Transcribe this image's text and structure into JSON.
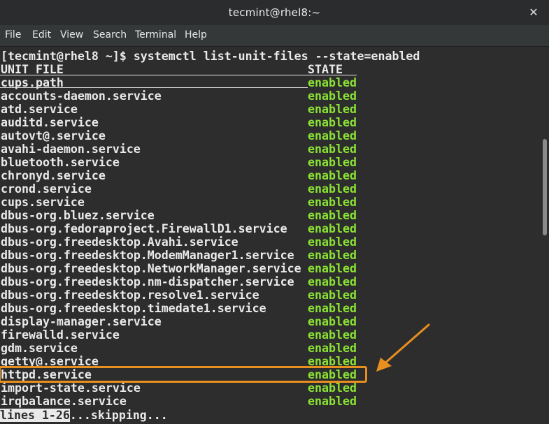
{
  "window": {
    "title": "tecmint@rhel8:~",
    "close_glyph": "✕"
  },
  "menu": [
    "File",
    "Edit",
    "View",
    "Search",
    "Terminal",
    "Help"
  ],
  "terminal": {
    "prompt_line": "[tecmint@rhel8 ~]$ systemctl list-unit-files --state=enabled",
    "header": {
      "unit": "UNIT FILE",
      "state": "STATE"
    },
    "rows": [
      {
        "unit": "cups.path",
        "state": "enabled"
      },
      {
        "unit": "accounts-daemon.service",
        "state": "enabled"
      },
      {
        "unit": "atd.service",
        "state": "enabled"
      },
      {
        "unit": "auditd.service",
        "state": "enabled"
      },
      {
        "unit": "autovt@.service",
        "state": "enabled"
      },
      {
        "unit": "avahi-daemon.service",
        "state": "enabled"
      },
      {
        "unit": "bluetooth.service",
        "state": "enabled"
      },
      {
        "unit": "chronyd.service",
        "state": "enabled"
      },
      {
        "unit": "crond.service",
        "state": "enabled"
      },
      {
        "unit": "cups.service",
        "state": "enabled"
      },
      {
        "unit": "dbus-org.bluez.service",
        "state": "enabled"
      },
      {
        "unit": "dbus-org.fedoraproject.FirewallD1.service",
        "state": "enabled"
      },
      {
        "unit": "dbus-org.freedesktop.Avahi.service",
        "state": "enabled"
      },
      {
        "unit": "dbus-org.freedesktop.ModemManager1.service",
        "state": "enabled"
      },
      {
        "unit": "dbus-org.freedesktop.NetworkManager.service",
        "state": "enabled"
      },
      {
        "unit": "dbus-org.freedesktop.nm-dispatcher.service",
        "state": "enabled"
      },
      {
        "unit": "dbus-org.freedesktop.resolve1.service",
        "state": "enabled"
      },
      {
        "unit": "dbus-org.freedesktop.timedate1.service",
        "state": "enabled"
      },
      {
        "unit": "display-manager.service",
        "state": "enabled"
      },
      {
        "unit": "firewalld.service",
        "state": "enabled"
      },
      {
        "unit": "gdm.service",
        "state": "enabled"
      },
      {
        "unit": "getty@.service",
        "state": "enabled"
      },
      {
        "unit": "httpd.service",
        "state": "enabled"
      },
      {
        "unit": "import-state.service",
        "state": "enabled"
      },
      {
        "unit": "irqbalance.service",
        "state": "enabled"
      }
    ],
    "pager": {
      "inverse": "lines 1-26",
      "rest": "...skipping..."
    },
    "highlighted_unit": "httpd.service"
  },
  "colors": {
    "enabled": "#8ae234",
    "highlight": "#e8901f",
    "background": "#2d2d2d",
    "text": "#eaeaea"
  }
}
